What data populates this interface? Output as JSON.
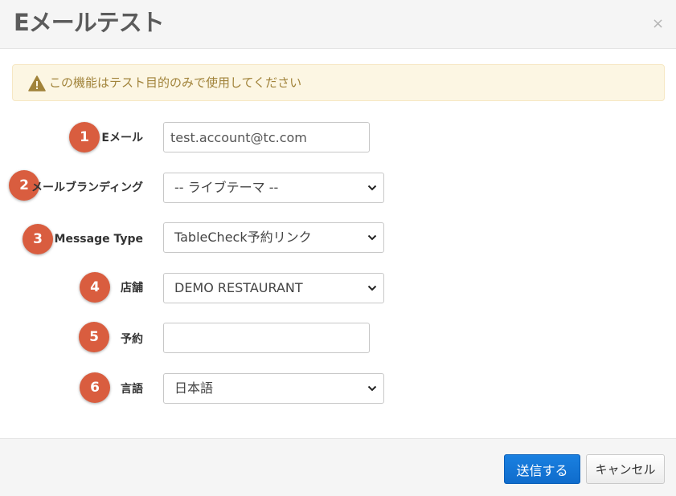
{
  "header": {
    "title": "Eメールテスト",
    "close_label": "×"
  },
  "alert": {
    "text": "この機能はテスト目的のみで使用してください",
    "icon": "warning-icon"
  },
  "fields": [
    {
      "number": "1",
      "label": "Eメール",
      "type": "text",
      "value": "test.account@tc.com"
    },
    {
      "number": "2",
      "label": "メールブランディング",
      "type": "select",
      "value": "-- ライブテーマ --"
    },
    {
      "number": "3",
      "label": "Message Type",
      "type": "select",
      "value": "TableCheck予約リンク"
    },
    {
      "number": "4",
      "label": "店舗",
      "type": "select",
      "value": "DEMO RESTAURANT"
    },
    {
      "number": "5",
      "label": "予約",
      "type": "text",
      "value": ""
    },
    {
      "number": "6",
      "label": "言語",
      "type": "select",
      "value": "日本語"
    }
  ],
  "footer": {
    "send_label": "送信する",
    "cancel_label": "キャンセル"
  },
  "colors": {
    "badge": "#d95d3f",
    "primary_button": "#1a80e0",
    "alert_bg": "#fcf6e3",
    "alert_text": "#a1833a"
  }
}
